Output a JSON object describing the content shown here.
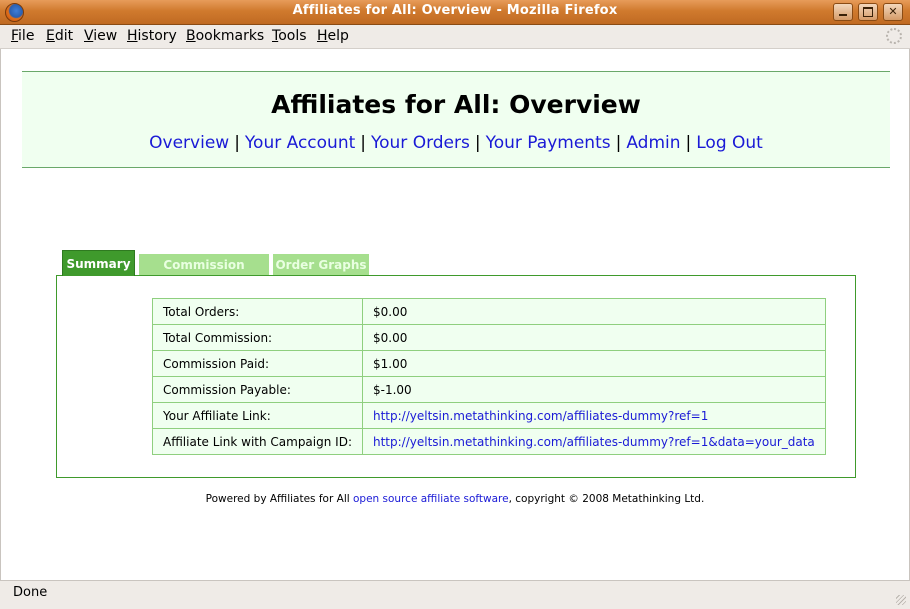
{
  "window": {
    "title": "Affiliates for All: Overview - Mozilla Firefox",
    "min_label": "",
    "max_label": "",
    "close_label": "✕"
  },
  "menu": {
    "items": [
      "File",
      "Edit",
      "View",
      "History",
      "Bookmarks",
      "Tools",
      "Help"
    ]
  },
  "page": {
    "title": "Affiliates for All: Overview",
    "nav": [
      "Overview",
      "Your Account",
      "Your Orders",
      "Your Payments",
      "Admin",
      "Log Out"
    ],
    "nav_separator": "|"
  },
  "tabs": [
    {
      "label": "Summary",
      "active": true
    },
    {
      "label": "Commission Graphs",
      "active": false
    },
    {
      "label": "Order Graphs",
      "active": false
    }
  ],
  "summary": {
    "rows": [
      {
        "label": "Total Orders:",
        "value": "$0.00"
      },
      {
        "label": "Total Commission:",
        "value": "$0.00"
      },
      {
        "label": "Commission Paid:",
        "value": "$1.00"
      },
      {
        "label": "Commission Payable:",
        "value": "$-1.00"
      },
      {
        "label": "Your Affiliate Link:",
        "value": "http://yeltsin.metathinking.com/affiliates-dummy?ref=1"
      },
      {
        "label": "Affiliate Link with Campaign ID:",
        "value": "http://yeltsin.metathinking.com/affiliates-dummy?ref=1&data=your_data"
      }
    ]
  },
  "footer": {
    "prefix": "Powered by Affiliates for All ",
    "link": "open source affiliate software",
    "suffix": ", copyright © 2008 Metathinking Ltd."
  },
  "status": {
    "text": "Done"
  },
  "colors": {
    "title_bar": "#d07a2e",
    "link": "#1a1ad6",
    "tab_active": "#3f9a2c",
    "tab_inactive": "#a6df8e",
    "header_bg": "#f0fff0"
  }
}
